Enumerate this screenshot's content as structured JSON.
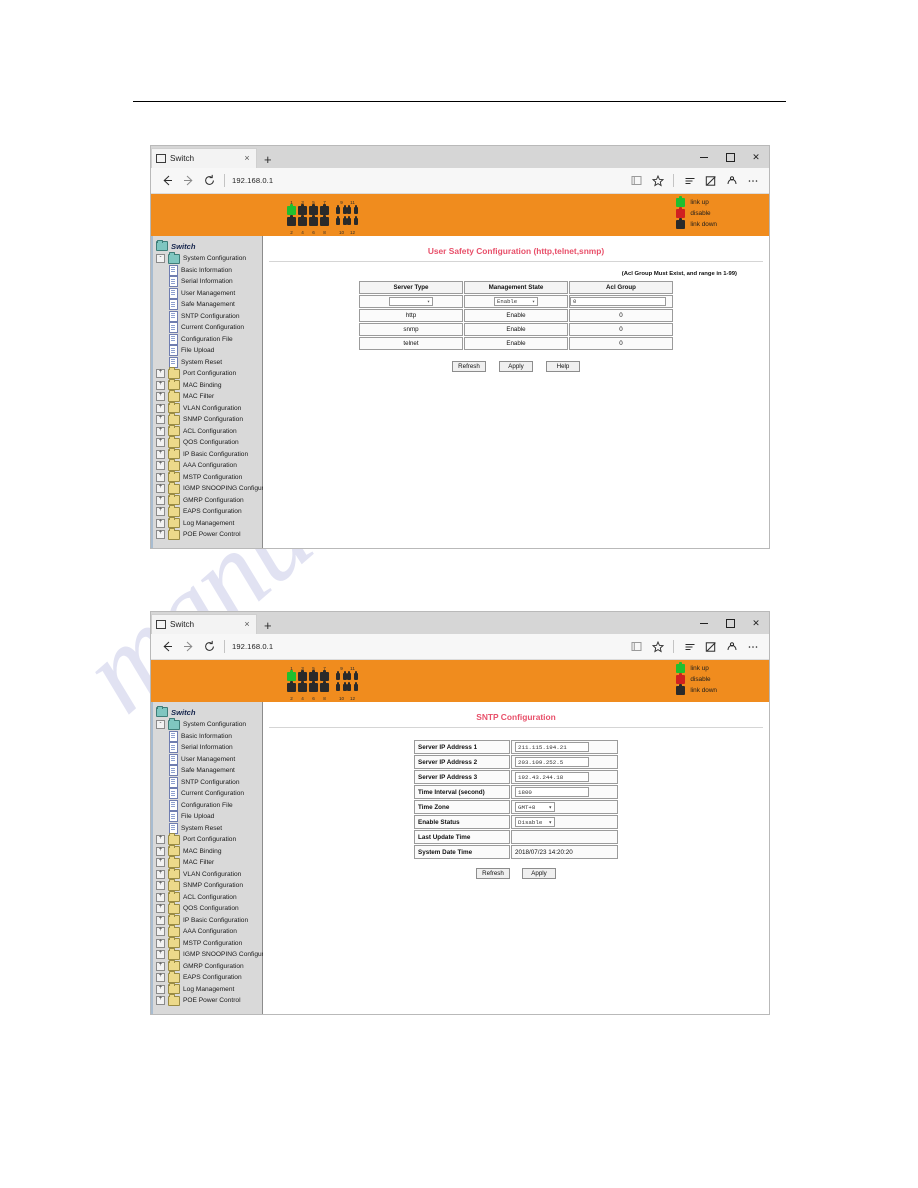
{
  "watermark": {
    "text": "manualslive.com"
  },
  "browser": {
    "tab_title": "Switch",
    "tab_close_label": "×",
    "new_tab_label": "+",
    "url": "192.168.0.1",
    "back_icon": "back-arrow-icon",
    "forward_icon": "forward-arrow-icon",
    "refresh_icon": "refresh-icon",
    "reading_list_icon": "reading-list-icon",
    "favorite_icon": "star-icon",
    "hub_icon": "hub-lines-icon",
    "notes_icon": "note-pen-icon",
    "share_icon": "share-icon",
    "more_icon": "ellipsis-icon",
    "minimize_label": "–",
    "maximize_label": "□",
    "close_label": "✕"
  },
  "banner": {
    "ports_top": [
      "1",
      "3",
      "5",
      "7",
      "9",
      "11"
    ],
    "ports_bottom": [
      "2",
      "4",
      "6",
      "8",
      "10",
      "12"
    ],
    "legend": [
      {
        "label": "link up",
        "color": "#1fbf2f"
      },
      {
        "label": "disable",
        "color": "#d02020"
      },
      {
        "label": "link down",
        "color": "#2a2a2a"
      }
    ]
  },
  "sidebar": {
    "root": "Switch",
    "group": "System Configuration",
    "children": [
      "Basic Information",
      "Serial Information",
      "User Management",
      "Safe Management",
      "SNTP Configuration",
      "Current Configuration",
      "Configuration File",
      "File Upload",
      "System Reset"
    ],
    "folders": [
      "Port Configuration",
      "MAC Binding",
      "MAC Filter",
      "VLAN Configuration",
      "SNMP Configuration",
      "ACL Configuration",
      "QOS Configuration",
      "IP Basic Configuration",
      "AAA Configuration",
      "MSTP Configuration",
      "IGMP SNOOPING Configur",
      "GMRP Configuration",
      "EAPS Configuration",
      "Log Management",
      "POE Power Control"
    ],
    "expand_plus": "+",
    "expand_minus": "-"
  },
  "window1": {
    "title": "User Safety Configuration (http,telnet,snmp)",
    "hint": "(Acl Group Must Exist, and range in 1-99)",
    "table": {
      "headers": [
        "Server Type",
        "Management State",
        "Acl Group"
      ],
      "edit_row": {
        "server_type_value": "",
        "management_state_value": "Enable",
        "acl_group_value": "0"
      },
      "rows": [
        {
          "server_type": "http",
          "management_state": "Enable",
          "acl_group": "0"
        },
        {
          "server_type": "snmp",
          "management_state": "Enable",
          "acl_group": "0"
        },
        {
          "server_type": "telnet",
          "management_state": "Enable",
          "acl_group": "0"
        }
      ]
    },
    "buttons": [
      "Refresh",
      "Apply",
      "Help"
    ]
  },
  "window2": {
    "title": "SNTP Configuration",
    "fields": [
      {
        "label": "Server IP Address 1",
        "value": "211.115.194.21",
        "type": "input"
      },
      {
        "label": "Server IP Address 2",
        "value": "203.109.252.5",
        "type": "input"
      },
      {
        "label": "Server IP Address 3",
        "value": "192.43.244.18",
        "type": "input"
      },
      {
        "label": "Time Interval (second)",
        "value": "1800",
        "type": "input"
      },
      {
        "label": "Time Zone",
        "value": "GMT+8",
        "type": "select"
      },
      {
        "label": "Enable Status",
        "value": "Disable",
        "type": "select"
      },
      {
        "label": "Last Update Time",
        "value": "",
        "type": "text"
      },
      {
        "label": "System Date Time",
        "value": "2018/07/23 14:20:20",
        "type": "text"
      }
    ],
    "buttons": [
      "Refresh",
      "Apply"
    ]
  },
  "colors": {
    "banner_orange": "#f08c1e",
    "title_red": "#e8506a",
    "sidebar_gray": "#d9d9d9",
    "watermark": "#c9cbe8"
  }
}
